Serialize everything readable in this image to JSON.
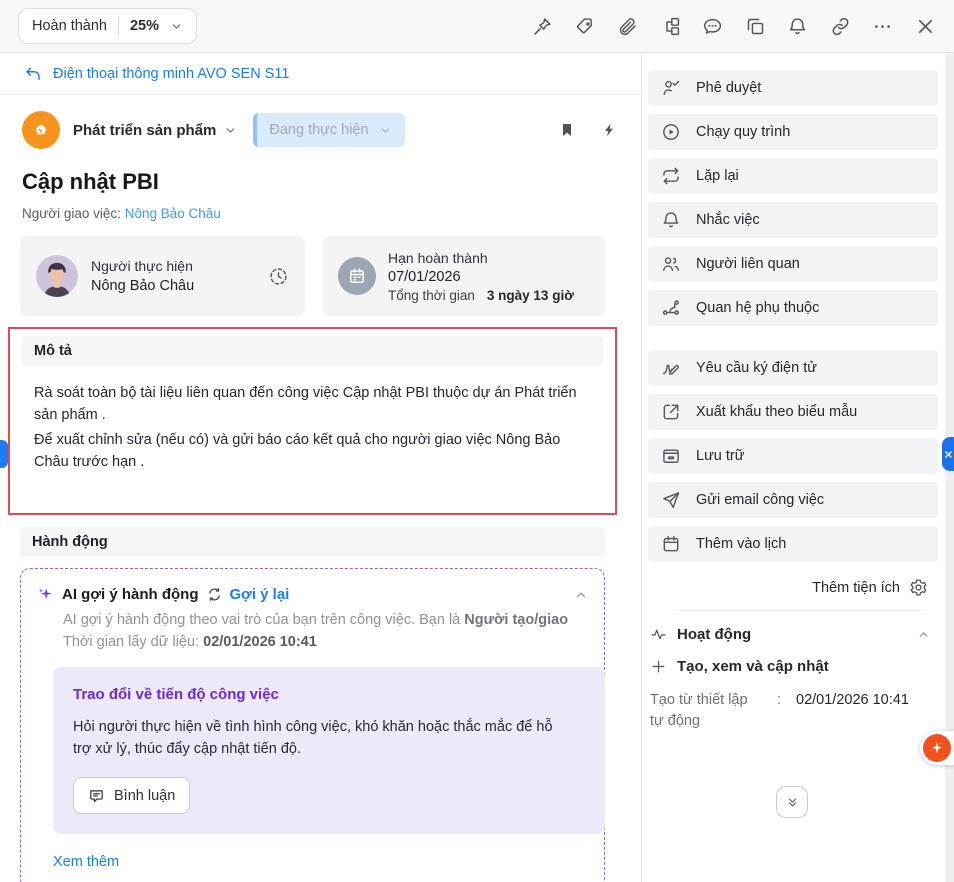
{
  "topbar": {
    "complete_label": "Hoàn thành",
    "progress": "25%",
    "icons": [
      "pin",
      "tag",
      "attachment",
      "subtasks",
      "comment",
      "copy",
      "bell",
      "link",
      "more",
      "close"
    ]
  },
  "breadcrumb": {
    "back_label": "Điện thoại thông minh AVO SEN S11"
  },
  "header": {
    "project": "Phát triển sản phẩm",
    "status": "Đang thực hiện",
    "title": "Cập nhật PBI",
    "assigner_label": "Người giao việc:",
    "assigner_name": "Nông Bảo Châu"
  },
  "cards": {
    "assignee": {
      "label": "Người thực hiện",
      "name": "Nông Bảo Châu"
    },
    "deadline": {
      "label": "Hạn hoàn thành",
      "date": "07/01/2026",
      "total_label": "Tổng thời gian",
      "total_value": "3 ngày 13 giờ"
    }
  },
  "description": {
    "title": "Mô tả",
    "line1": "Rà soát toàn bộ tài liệu liên quan đến công việc Cập nhật PBI thuộc dự án Phát triển sản phẩm .",
    "line2": "Để xuất chỉnh sửa (nếu có) và gửi báo cáo kết quả cho người giao việc Nông Bảo Châu trước hạn ."
  },
  "actions_section": {
    "title": "Hành động",
    "ai": {
      "title": "AI gợi ý hành động",
      "regen_label": "Gợi ý lại",
      "subtitle_prefix": "AI gợi ý hành động theo vai trò của bạn trên công việc. Bạn là ",
      "subtitle_role": "Người tạo/giao",
      "time_label": "Thời gian lấy dữ liệu: ",
      "time_value": "02/01/2026 10:41",
      "suggestion": {
        "title": "Trao đổi về tiến độ công việc",
        "body": "Hỏi người thực hiện về tình hình công việc, khó khăn hoặc thắc mắc để hỗ trợ xử lý, thúc đẩy cập nhật tiến độ.",
        "button": "Bình luận"
      },
      "more_label": "Xem thêm"
    }
  },
  "sidebar": {
    "items": [
      {
        "label": "Phê duyệt",
        "icon": "approve-icon"
      },
      {
        "label": "Chạy quy trình",
        "icon": "run-process-icon"
      },
      {
        "label": "Lặp lại",
        "icon": "repeat-icon"
      },
      {
        "label": "Nhắc việc",
        "icon": "reminder-icon"
      },
      {
        "label": "Người liên quan",
        "icon": "related-people-icon"
      },
      {
        "label": "Quan hệ phụ thuộc",
        "icon": "dependency-icon"
      },
      {
        "label": "Yêu cầu ký điện tử",
        "icon": "e-signature-icon"
      },
      {
        "label": "Xuất khẩu theo biểu mẫu",
        "icon": "export-template-icon"
      },
      {
        "label": "Lưu trữ",
        "icon": "archive-icon"
      },
      {
        "label": "Gửi email công việc",
        "icon": "send-email-icon"
      },
      {
        "label": "Thêm vào lịch",
        "icon": "add-to-calendar-icon"
      }
    ],
    "add_widget_label": "Thêm tiện ích",
    "activity": {
      "title": "Hoạt động",
      "subtitle": "Tạo, xem và cập nhật",
      "row_label": "Tạo từ thiết lập tự động",
      "row_sep": ":",
      "row_value": "02/01/2026 10:41"
    }
  },
  "colors": {
    "accent_blue": "#1a7cf0",
    "accent_purple": "#6d28d9",
    "annotation_red": "#df4b50",
    "project_orange": "#f7941e",
    "fab_orange": "#f4511e",
    "status_bg": "#d9eafb"
  }
}
